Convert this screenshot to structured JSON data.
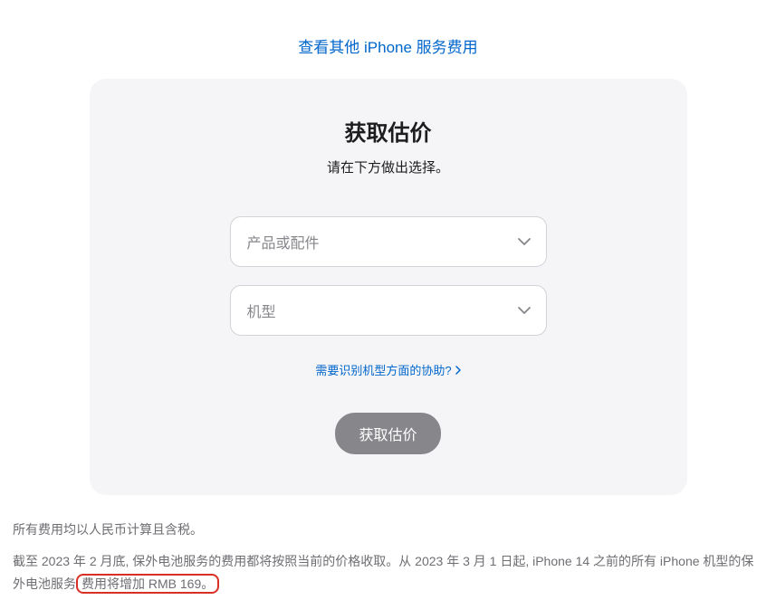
{
  "topLink": {
    "label": "查看其他 iPhone 服务费用"
  },
  "card": {
    "title": "获取估价",
    "subtitle": "请在下方做出选择。",
    "productSelect": {
      "placeholder": "产品或配件"
    },
    "modelSelect": {
      "placeholder": "机型"
    },
    "helpLink": {
      "label": "需要识别机型方面的协助?"
    },
    "submitButton": {
      "label": "获取估价"
    }
  },
  "footer": {
    "note1": "所有费用均以人民币计算且含税。",
    "note2_part1": "截至 2023 年 2 月底, 保外电池服务的费用都将按照当前的价格收取。从 2023 年 3 月 1 日起, iPhone 14 之前的所有 iPhone 机型的保外电池服务",
    "note2_highlight": "费用将增加 RMB 169。"
  }
}
